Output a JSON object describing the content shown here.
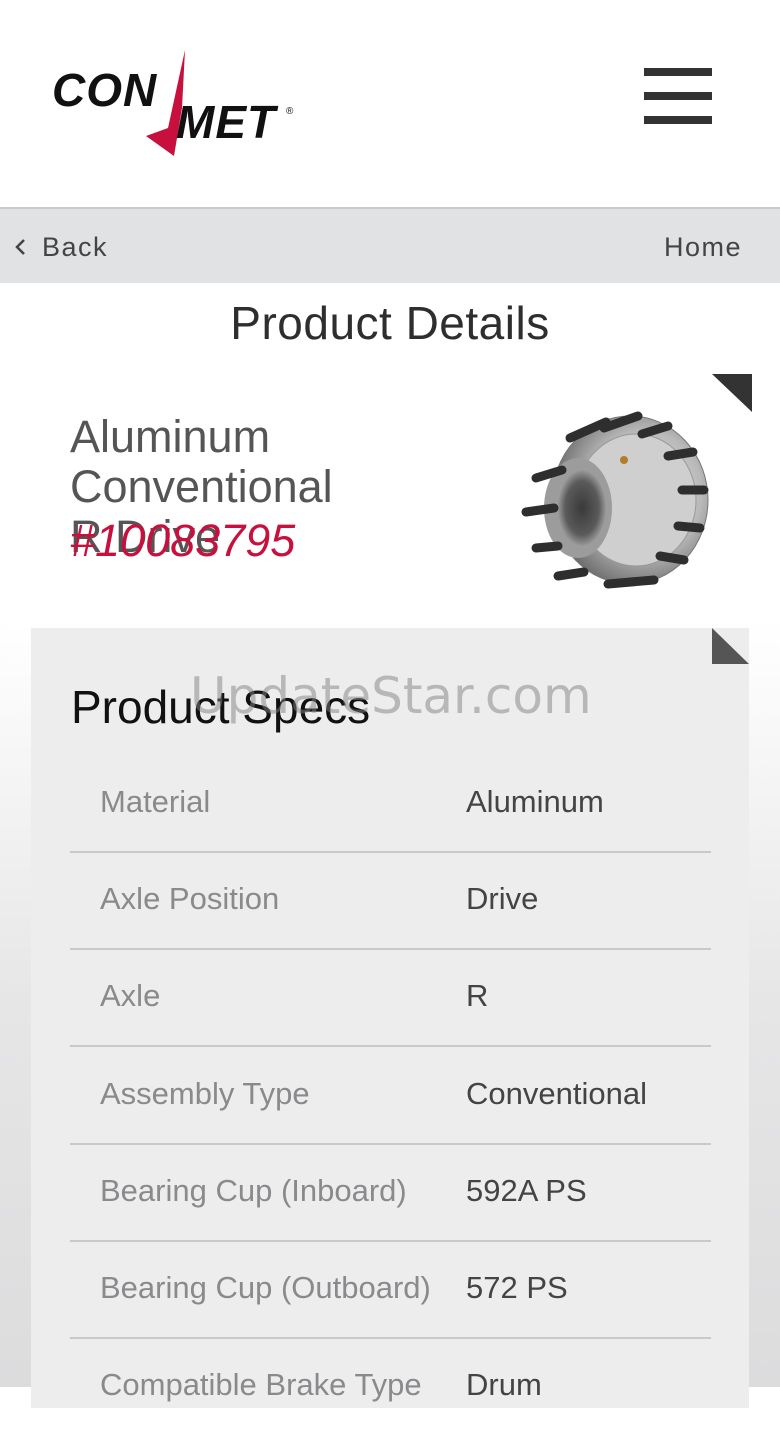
{
  "header": {
    "logo_top": "CON",
    "logo_bottom": "MET",
    "logo_mark": "®",
    "menu_icon": "hamburger-menu-icon"
  },
  "nav": {
    "back_label": "Back",
    "back_icon": "chevron-left-icon",
    "home_label": "Home"
  },
  "page": {
    "title": "Product Details"
  },
  "product": {
    "name_line1": "Aluminum Conventional",
    "name_line2": "R Drive",
    "number": "#10083795",
    "image": "wheel-hub-image"
  },
  "specs": {
    "title": "Product Specs",
    "rows": [
      {
        "label": "Material",
        "value": "Aluminum"
      },
      {
        "label": "Axle Position",
        "value": "Drive"
      },
      {
        "label": "Axle",
        "value": "R"
      },
      {
        "label": "Assembly Type",
        "value": "Conventional"
      },
      {
        "label": "Bearing Cup (Inboard)",
        "value": "592A PS"
      },
      {
        "label": "Bearing Cup (Outboard)",
        "value": "572 PS"
      },
      {
        "label": "Compatible Brake Type",
        "value": "Drum"
      }
    ]
  },
  "watermark": "UpdateStar.com",
  "colors": {
    "brand_red": "#c8103e",
    "nav_bg": "#e1e2e4",
    "panel_bg": "#ededee"
  }
}
